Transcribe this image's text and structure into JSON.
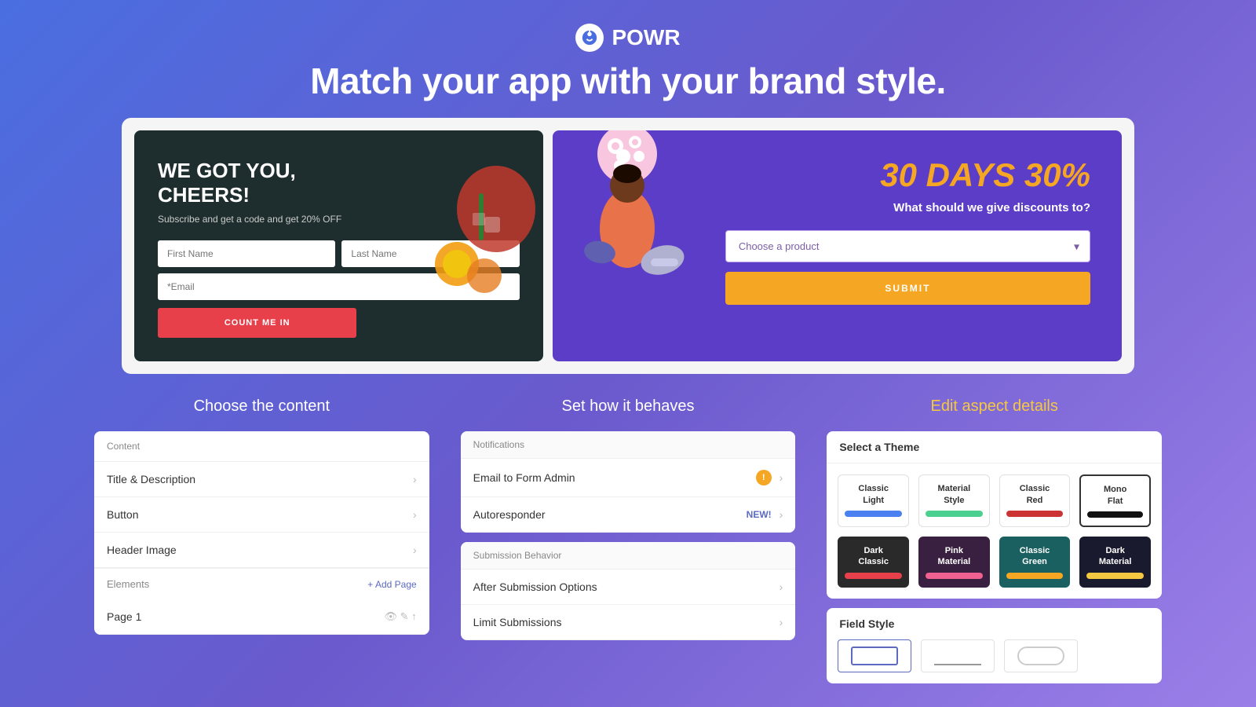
{
  "header": {
    "logo_text": "POWR",
    "headline": "Match your app with your brand style."
  },
  "preview": {
    "left_panel": {
      "title": "WE GOT YOU, CHEERS!",
      "subtitle": "Subscribe and get a code and get 20% OFF",
      "first_name_placeholder": "First Name",
      "last_name_placeholder": "Last Name",
      "email_placeholder": "*Email",
      "button_label": "COUNT ME IN"
    },
    "right_panel": {
      "title": "30 DAYS 30%",
      "subtitle": "What should we give discounts to?",
      "select_placeholder": "Choose a product",
      "button_label": "SUBMIT"
    }
  },
  "sections": {
    "content": {
      "title": "Choose the content",
      "card_header": "Content",
      "items": [
        "Title & Description",
        "Button",
        "Header Image"
      ],
      "footer_label": "Elements",
      "add_page": "+ Add Page",
      "page_label": "Page 1"
    },
    "behavior": {
      "title": "Set how it behaves",
      "notifications_header": "Notifications",
      "notifications_items": [
        {
          "label": "Email to Form Admin",
          "badge": "warning",
          "has_chevron": true
        },
        {
          "label": "Autoresponder",
          "badge": "new",
          "badge_text": "NEW!",
          "has_chevron": true
        }
      ],
      "submission_header": "Submission Behavior",
      "submission_items": [
        {
          "label": "After Submission Options",
          "has_chevron": true
        },
        {
          "label": "Limit Submissions",
          "has_chevron": true
        }
      ]
    },
    "appearance": {
      "title": "Edit aspect details",
      "select_theme_label": "Select a Theme",
      "themes": [
        {
          "name": "Classic Light",
          "swatch_color": "#4a80f0",
          "dark": false,
          "selected": false
        },
        {
          "name": "Material Style",
          "swatch_color": "#4cd090",
          "dark": false,
          "selected": false
        },
        {
          "name": "Classic Red",
          "swatch_color": "#cc3333",
          "dark": false,
          "selected": false
        },
        {
          "name": "Mono Flat",
          "swatch_color": "#111111",
          "dark": false,
          "selected": true
        },
        {
          "name": "Dark Classic",
          "swatch_color": "#e8404a",
          "dark": true,
          "selected": false
        },
        {
          "name": "Pink Material",
          "swatch_color": "#f06090",
          "dark": true,
          "selected": false
        },
        {
          "name": "Classic Green",
          "swatch_color": "#f5a623",
          "dark": false,
          "teal": true,
          "selected": false
        },
        {
          "name": "Dark Material",
          "swatch_color": "#f5c842",
          "dark": true,
          "selected": false
        }
      ],
      "field_style_label": "Field Style"
    }
  }
}
